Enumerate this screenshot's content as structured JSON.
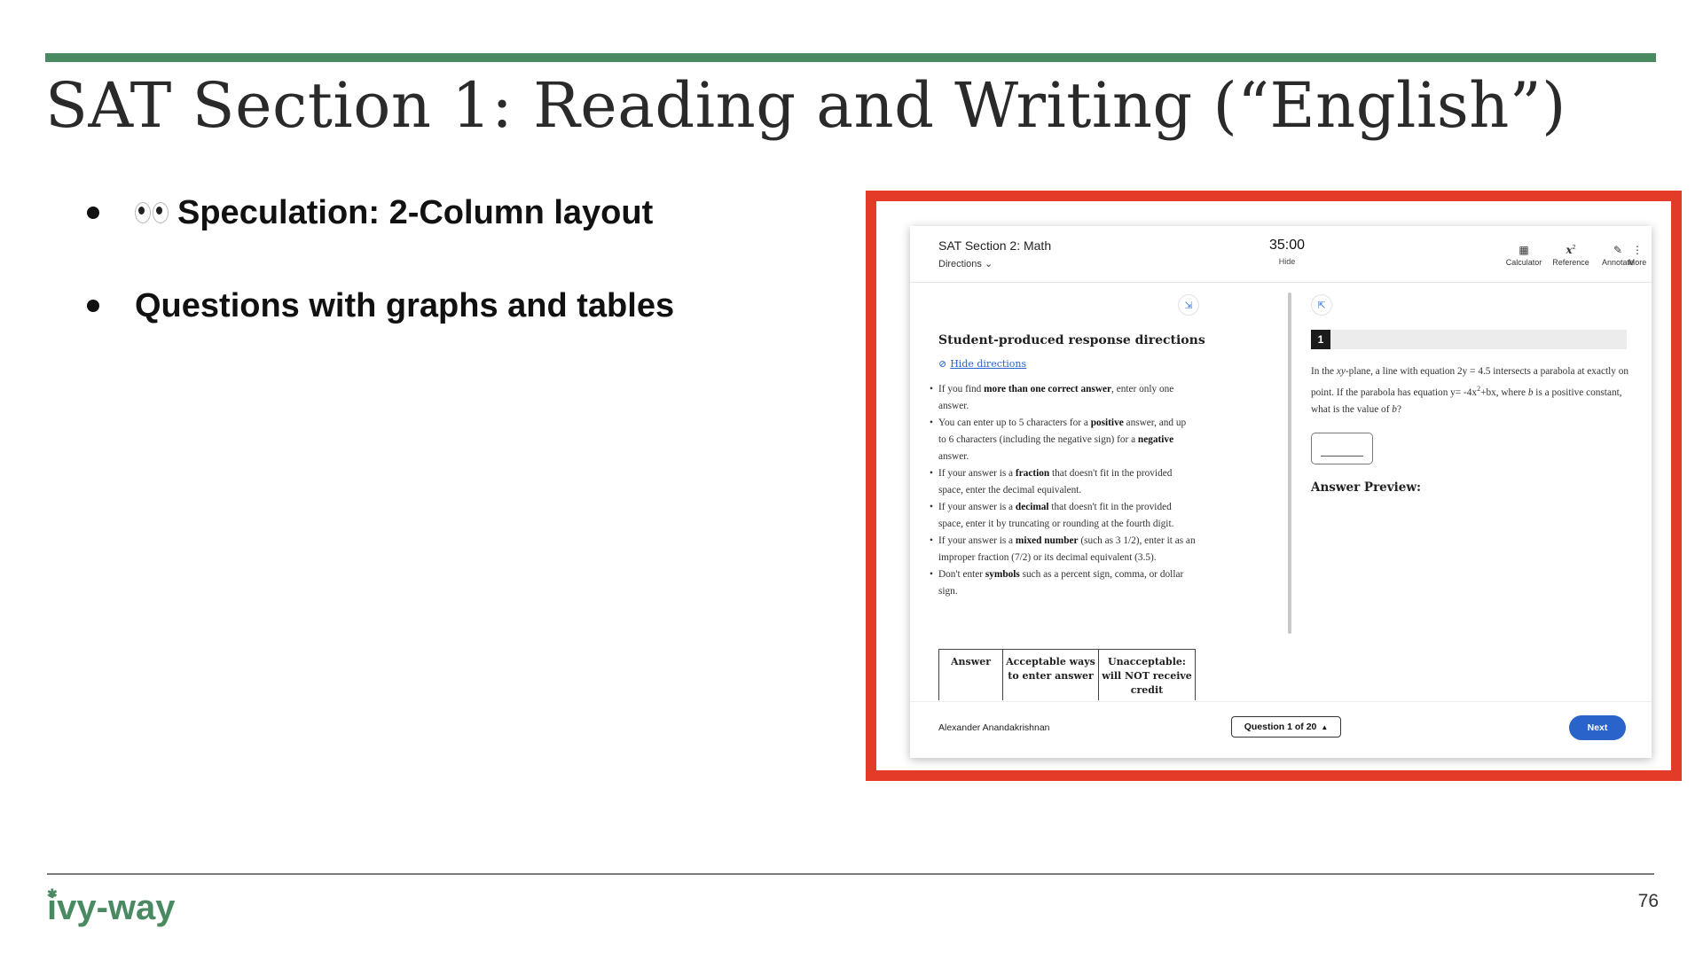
{
  "slide": {
    "title": "SAT Section 1: Reading and Writing (“English”)",
    "bullets": [
      "Speculation: 2-Column layout",
      "Questions with graphs and tables"
    ],
    "page_number": "76",
    "logo_text": "ivy-way"
  },
  "colors": {
    "accent_green": "#4a8a62",
    "highlight_red": "#e23b28",
    "button_blue": "#2a63c9"
  },
  "app": {
    "section_title": "SAT Section 2: Math",
    "directions_label": "Directions",
    "timer": "35:00",
    "timer_hide": "Hide",
    "tools": [
      {
        "label": "Calculator",
        "icon": "calculator-icon"
      },
      {
        "label": "Reference",
        "icon": "formula-icon"
      },
      {
        "label": "Annotate",
        "icon": "pen-icon"
      },
      {
        "label": "More",
        "icon": "more-vertical-icon"
      }
    ]
  },
  "directions": {
    "title": "Student-produced response directions",
    "hide_link": "Hide directions",
    "items": [
      [
        "If you find ",
        "more than one correct answer",
        ", enter only one answer."
      ],
      [
        "You can enter up to 5 characters for a ",
        "positive",
        " answer, and up to 6 characters (including the negative sign) for a ",
        "negative",
        " answer."
      ],
      [
        "If your answer is a ",
        "fraction",
        " that doesn't fit in the provided space, enter the decimal equivalent."
      ],
      [
        "If your answer is a ",
        "decimal",
        " that doesn't fit in the provided space, enter it by truncating or rounding at the fourth digit."
      ],
      [
        "If your answer is a ",
        "mixed number",
        " (such as 3 1/2), enter it as an improper fraction (7/2) or its decimal equivalent (3.5)."
      ],
      [
        "Don't enter ",
        "symbols",
        " such as a percent sign, comma, or dollar sign."
      ]
    ],
    "table_headers": [
      "Answer",
      "Acceptable ways to enter answer",
      "Unacceptable: will NOT receive credit"
    ]
  },
  "question": {
    "number": "1",
    "text_parts": [
      "In the ",
      "xy",
      "-plane, a line with equation 2y = 4.5 intersects a parabola at exactly on point. If the parabola has equation y= -4x",
      "2",
      "+bx, where ",
      "b",
      " is a positive constant, what is the value of ",
      "b",
      "?"
    ],
    "answer_preview_label": "Answer Preview:"
  },
  "footer": {
    "student_name": "Alexander Anandakrishnan",
    "question_progress": "Question 1 of 20",
    "next_label": "Next"
  }
}
